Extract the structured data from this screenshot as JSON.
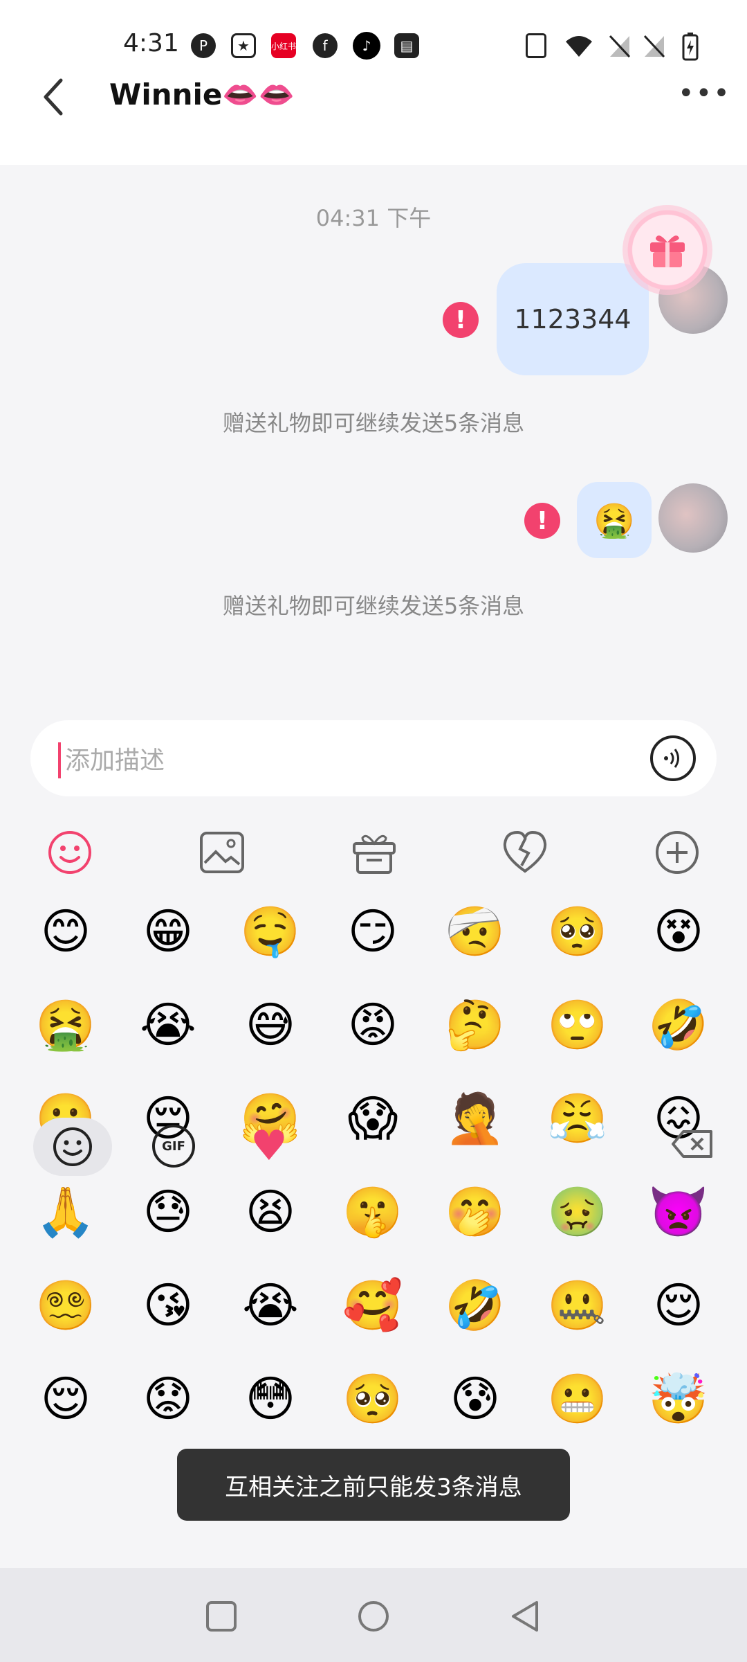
{
  "status": {
    "time": "4:31",
    "app_icons": [
      "pinterest-icon",
      "star-app-icon",
      "xiaohongshu-icon",
      "facebook-icon",
      "tiktok-icon",
      "wallet-icon"
    ],
    "system_icons": [
      "vibrate-icon",
      "wifi-icon",
      "no-signal-icon",
      "no-signal-icon",
      "battery-charging-icon"
    ]
  },
  "header": {
    "title": "Winnie👄👄",
    "more": "•••"
  },
  "chat": {
    "timestamp": "04:31 下午",
    "message1": "1123344",
    "error_mark": "!",
    "hint1": "赠送礼物即可继续发送5条消息",
    "message2_emoji": "🤮",
    "hint2": "赠送礼物即可继续发送5条消息"
  },
  "input": {
    "placeholder": "添加描述"
  },
  "toolbar": {
    "icons": [
      "emoji-icon",
      "image-icon",
      "gift-icon",
      "broken-heart-icon",
      "plus-icon"
    ]
  },
  "emojis": [
    [
      "😊",
      "😁",
      "🤤",
      "😏",
      "🤕",
      "🥺",
      "😵"
    ],
    [
      "🤮",
      "😭",
      "😅",
      "😡",
      "🤔",
      "🙄",
      "🤣"
    ],
    [
      "🥲",
      "😔",
      "🤗",
      "😱",
      "🤦",
      "😤",
      "😖"
    ],
    [
      "🙏",
      "😓",
      "😫",
      "🤫",
      "🤭",
      "🤢",
      "👿"
    ],
    [
      "😵‍💫",
      "😘",
      "😭",
      "🥰",
      "🤣",
      "🤐",
      "😌"
    ],
    [
      "😌",
      "😟",
      "😳",
      "🥺",
      "😰",
      "😬",
      "🤯"
    ]
  ],
  "bottom": {
    "gif_label": "GIF",
    "heart": "♥"
  },
  "toast": "互相关注之前只能发3条消息",
  "colors": {
    "accent": "#f2426e",
    "bubble": "#dbe9ff",
    "background": "#f5f5f7"
  }
}
